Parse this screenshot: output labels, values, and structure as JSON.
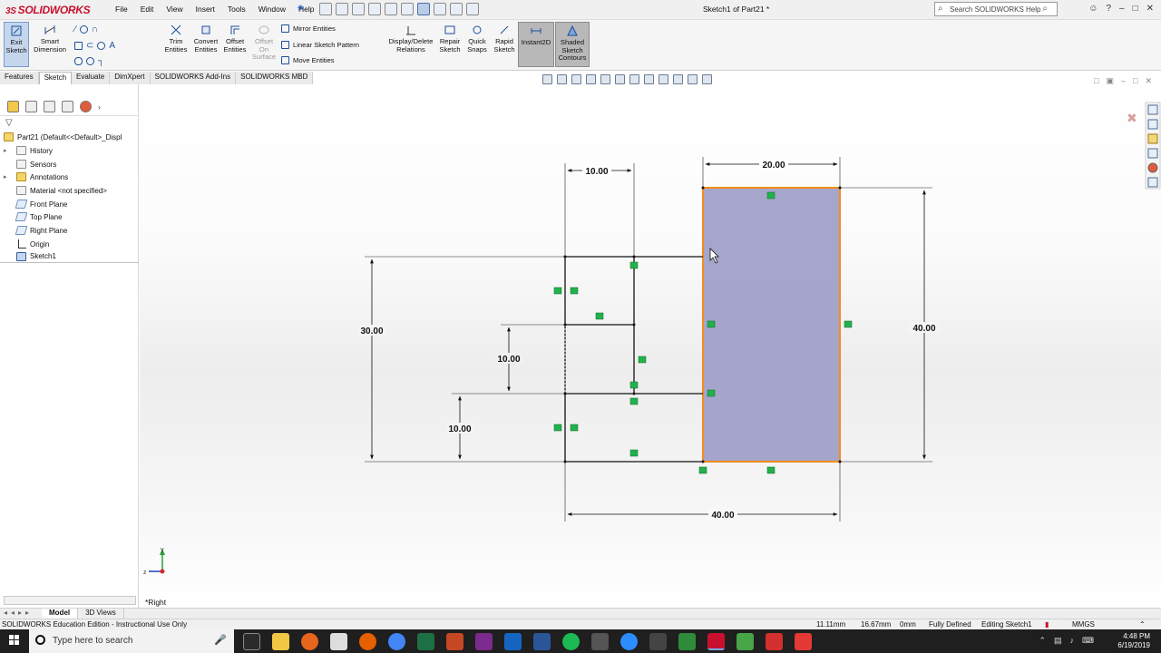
{
  "app": {
    "logo_ds": "3S",
    "logo_text": "SOLIDWORKS",
    "document_title": "Sketch1 of Part21 *"
  },
  "menu": [
    "File",
    "Edit",
    "View",
    "Insert",
    "Tools",
    "Window",
    "Help"
  ],
  "search": {
    "placeholder": "Search SOLIDWORKS Help"
  },
  "commands": {
    "exit_sketch": "Exit Sketch",
    "smart_dimension": "Smart Dimension",
    "trim_entities": "Trim Entities",
    "convert_entities": "Convert Entities",
    "offset_entities": "Offset Entities",
    "offset_on_surface": "Offset On Surface",
    "mirror_entities": "Mirror Entities",
    "linear_sketch_pattern": "Linear Sketch Pattern",
    "move_entities": "Move Entities",
    "display_delete_relations": "Display/Delete Relations",
    "repair_sketch": "Repair Sketch",
    "quick_snaps": "Quick Snaps",
    "rapid_sketch": "Rapid Sketch",
    "instant2d": "Instant2D",
    "shaded_sketch_contours": "Shaded Sketch Contours"
  },
  "tabs": [
    "Features",
    "Sketch",
    "Evaluate",
    "DimXpert",
    "SOLIDWORKS Add-Ins",
    "SOLIDWORKS MBD"
  ],
  "active_tab": "Sketch",
  "tree": {
    "part": "Part21  (Default<<Default>_Displ",
    "items": [
      {
        "label": "History",
        "arrow": "▸"
      },
      {
        "label": "Sensors",
        "arrow": ""
      },
      {
        "label": "Annotations",
        "arrow": "▸"
      },
      {
        "label": "Material <not specified>",
        "arrow": ""
      },
      {
        "label": "Front Plane",
        "arrow": ""
      },
      {
        "label": "Top Plane",
        "arrow": ""
      },
      {
        "label": "Right Plane",
        "arrow": ""
      },
      {
        "label": "Origin",
        "arrow": ""
      },
      {
        "label": "Sketch1",
        "arrow": ""
      }
    ]
  },
  "sketch": {
    "dims": {
      "top_left_width": "10.00",
      "rect_width": "20.00",
      "left_height": "30.00",
      "mid_height": "10.00",
      "bottom_height": "10.00",
      "rect_height": "40.00",
      "total_width": "40.00"
    },
    "colors": {
      "selected": "#f28c1a",
      "fill": "#9c9cc6",
      "relation": "#22b14c"
    }
  },
  "view_name": "*Right",
  "model_tabs": [
    "Model",
    "3D Views"
  ],
  "status": {
    "edition": "SOLIDWORKS Education Edition - Instructional Use Only",
    "x": "11.11mm",
    "y": "16.67mm",
    "z": "0mm",
    "state": "Fully Defined",
    "editing": "Editing Sketch1",
    "units": "MMGS"
  },
  "taskbar": {
    "search_placeholder": "Type here to search",
    "time": "4:48 PM",
    "date": "6/19/2019"
  }
}
